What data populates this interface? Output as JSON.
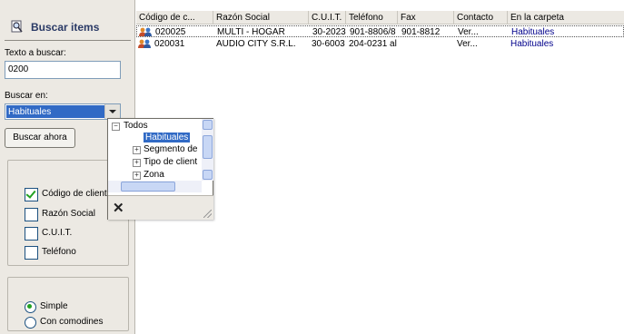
{
  "panel": {
    "title": "Buscar items",
    "search_label": "Texto a buscar:",
    "search_value": "0200",
    "search_in_label": "Buscar en:",
    "search_in_value": "Habituales",
    "search_button": "Buscar ahora",
    "fields": [
      {
        "label": "Código de client",
        "checked": true
      },
      {
        "label": "Razón Social",
        "checked": false
      },
      {
        "label": "C.U.I.T.",
        "checked": false
      },
      {
        "label": "Teléfono",
        "checked": false
      }
    ],
    "modes": [
      {
        "label": "Simple",
        "selected": true
      },
      {
        "label": "Con comodines",
        "selected": false
      }
    ]
  },
  "grid": {
    "columns": [
      "Código de c...",
      "Razón Social",
      "C.U.I.T.",
      "Teléfono",
      "Fax",
      "Contacto",
      "En la carpeta"
    ],
    "rows": [
      {
        "code": "020025",
        "name": "MULTI - HOGAR",
        "cuit": "30-2023",
        "phone": "901-8806/8",
        "fax": "901-8812",
        "contact": "Ver...",
        "folder": "Habituales"
      },
      {
        "code": "020031",
        "name": "AUDIO CITY S.R.L.",
        "cuit": "30-6003",
        "phone": "204-0231 al",
        "fax": "",
        "contact": "Ver...",
        "folder": "Habituales"
      }
    ]
  },
  "popup": {
    "root": "Todos",
    "items": [
      "Habituales",
      "Segmento de",
      "Tipo de client",
      "Zona"
    ],
    "close": "✕"
  },
  "colors": {
    "selection": "#316ac5",
    "link": "#00008b",
    "panel_bg": "#ece9e3",
    "check": "#21a121"
  }
}
